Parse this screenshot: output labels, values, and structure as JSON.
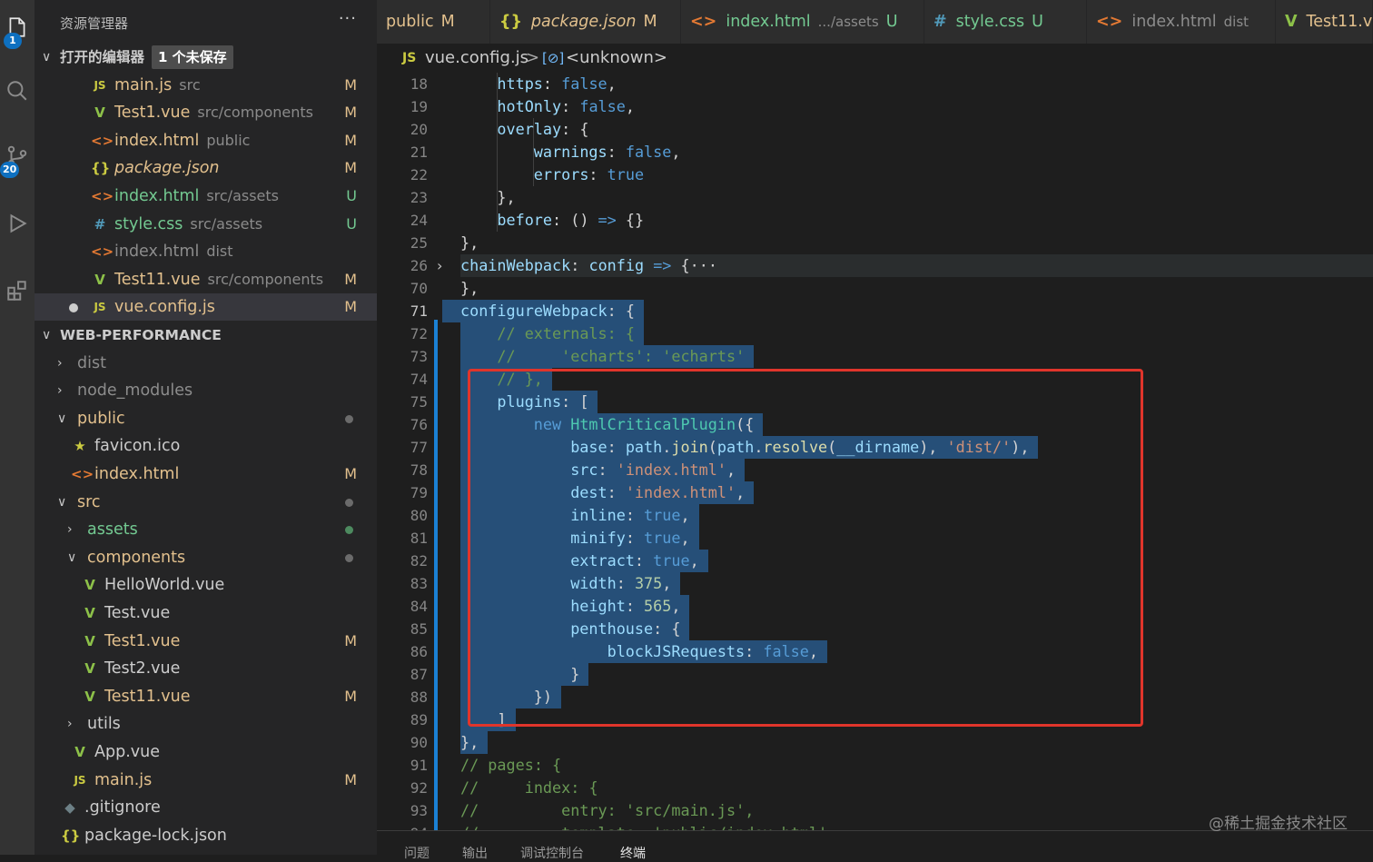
{
  "activity": {
    "explorer_badge": "1",
    "scm_badge": "20"
  },
  "sidebar": {
    "title": "资源管理器",
    "more": "···",
    "open_editors": {
      "label": "打开的编辑器",
      "unsaved": "1 个未保存",
      "items": [
        {
          "icon": "JS",
          "name": "main.js",
          "path": "src",
          "status": "M",
          "icon_color": "#cbcb41",
          "name_color": "#e2c08d"
        },
        {
          "icon": "V",
          "name": "Test1.vue",
          "path": "src/components",
          "status": "M",
          "icon_color": "#8dc149",
          "name_color": "#e2c08d"
        },
        {
          "icon": "<>",
          "name": "index.html",
          "path": "public",
          "status": "M",
          "icon_color": "#e37933",
          "name_color": "#e2c08d"
        },
        {
          "icon": "{}",
          "name": "package.json",
          "path": "",
          "status": "M",
          "icon_color": "#cbcb41",
          "name_color": "#e2c08d"
        },
        {
          "icon": "<>",
          "name": "index.html",
          "path": "src/assets",
          "status": "U",
          "icon_color": "#e37933",
          "name_color": "#73c991"
        },
        {
          "icon": "#",
          "name": "style.css",
          "path": "src/assets",
          "status": "U",
          "icon_color": "#519aba",
          "name_color": "#73c991"
        },
        {
          "icon": "<>",
          "name": "index.html",
          "path": "dist",
          "status": "",
          "icon_color": "#e37933",
          "name_color": "#8c8c8c"
        },
        {
          "icon": "V",
          "name": "Test11.vue",
          "path": "src/components",
          "status": "M",
          "icon_color": "#8dc149",
          "name_color": "#e2c08d"
        },
        {
          "icon": "JS",
          "name": "vue.config.js",
          "path": "",
          "status": "M",
          "icon_color": "#cbcb41",
          "name_color": "#e2c08d"
        }
      ]
    },
    "project": {
      "label": "WEB-PERFORMANCE",
      "tree": [
        {
          "name": "dist",
          "type": "folder",
          "open": false,
          "status": ""
        },
        {
          "name": "node_modules",
          "type": "folder",
          "open": false,
          "status": ""
        },
        {
          "name": "public",
          "type": "folder",
          "open": true,
          "status": "dot"
        },
        {
          "name": "favicon.ico",
          "type": "file",
          "icon": "★",
          "status": ""
        },
        {
          "name": "index.html",
          "type": "file",
          "icon": "<>",
          "status": "M"
        },
        {
          "name": "src",
          "type": "folder",
          "open": true,
          "status": "dot"
        },
        {
          "name": "assets",
          "type": "folder",
          "open": false,
          "status": "dot-green"
        },
        {
          "name": "components",
          "type": "folder",
          "open": true,
          "status": "dot"
        },
        {
          "name": "HelloWorld.vue",
          "type": "file",
          "icon": "V",
          "status": ""
        },
        {
          "name": "Test.vue",
          "type": "file",
          "icon": "V",
          "status": ""
        },
        {
          "name": "Test1.vue",
          "type": "file",
          "icon": "V",
          "status": "M"
        },
        {
          "name": "Test2.vue",
          "type": "file",
          "icon": "V",
          "status": ""
        },
        {
          "name": "Test11.vue",
          "type": "file",
          "icon": "V",
          "status": "M"
        },
        {
          "name": "utils",
          "type": "folder",
          "open": false,
          "status": ""
        },
        {
          "name": "App.vue",
          "type": "file",
          "icon": "V",
          "status": ""
        },
        {
          "name": "main.js",
          "type": "file",
          "icon": "JS",
          "status": "M"
        },
        {
          "name": ".gitignore",
          "type": "file",
          "icon": "◆",
          "status": ""
        },
        {
          "name": "package-lock.json",
          "type": "file",
          "icon": "{}",
          "status": ""
        }
      ]
    }
  },
  "tabs": [
    {
      "icon": "",
      "name": "public",
      "extra": "",
      "status": "M"
    },
    {
      "icon": "{}",
      "name": "package.json",
      "extra": "",
      "status": "M"
    },
    {
      "icon": "<>",
      "name": "index.html",
      "extra": ".../assets",
      "status": "U"
    },
    {
      "icon": "#",
      "name": "style.css",
      "extra": "",
      "status": "U"
    },
    {
      "icon": "<>",
      "name": "index.html",
      "extra": "dist",
      "status": ""
    },
    {
      "icon": "V",
      "name": "Test11.v",
      "extra": "",
      "status": ""
    }
  ],
  "breadcrumb": {
    "file_icon": "JS",
    "file": "vue.config.js",
    "sep": ">",
    "symbol": "<unknown>"
  },
  "editor": {
    "active_line": "71",
    "lines": [
      {
        "n": "18",
        "text": "https: false,"
      },
      {
        "n": "19",
        "text": "hotOnly: false,"
      },
      {
        "n": "20",
        "text": "overlay: {"
      },
      {
        "n": "21",
        "text": "warnings: false,"
      },
      {
        "n": "22",
        "text": "errors: true"
      },
      {
        "n": "23",
        "text": "},"
      },
      {
        "n": "24",
        "text": "before: () => {}"
      },
      {
        "n": "25",
        "text": "},"
      },
      {
        "n": "26",
        "text": "chainWebpack: config => {···"
      },
      {
        "n": "70",
        "text": "},"
      },
      {
        "n": "71",
        "text": "configureWebpack: {"
      },
      {
        "n": "72",
        "text": "// externals: {"
      },
      {
        "n": "73",
        "text": "//     'echarts': 'echarts'"
      },
      {
        "n": "74",
        "text": "// },"
      },
      {
        "n": "75",
        "text": "plugins: ["
      },
      {
        "n": "76",
        "text": "new HtmlCriticalPlugin({"
      },
      {
        "n": "77",
        "text": "base: path.join(path.resolve(__dirname), 'dist/'),"
      },
      {
        "n": "78",
        "text": "src: 'index.html',"
      },
      {
        "n": "79",
        "text": "dest: 'index.html',"
      },
      {
        "n": "80",
        "text": "inline: true,"
      },
      {
        "n": "81",
        "text": "minify: true,"
      },
      {
        "n": "82",
        "text": "extract: true,"
      },
      {
        "n": "83",
        "text": "width: 375,"
      },
      {
        "n": "84",
        "text": "height: 565,"
      },
      {
        "n": "85",
        "text": "penthouse: {"
      },
      {
        "n": "86",
        "text": "blockJSRequests: false,"
      },
      {
        "n": "87",
        "text": "}"
      },
      {
        "n": "88",
        "text": "})"
      },
      {
        "n": "89",
        "text": "]"
      },
      {
        "n": "90",
        "text": "},"
      },
      {
        "n": "91",
        "text": "// pages: {"
      },
      {
        "n": "92",
        "text": "//     index: {"
      },
      {
        "n": "93",
        "text": "//         entry: 'src/main.js',"
      },
      {
        "n": "94",
        "text": "//         template: 'public/index.html',"
      }
    ]
  },
  "panel": {
    "tabs": [
      "问题",
      "输出",
      "调试控制台",
      "终端"
    ]
  },
  "watermark": "@稀土掘金技术社区"
}
